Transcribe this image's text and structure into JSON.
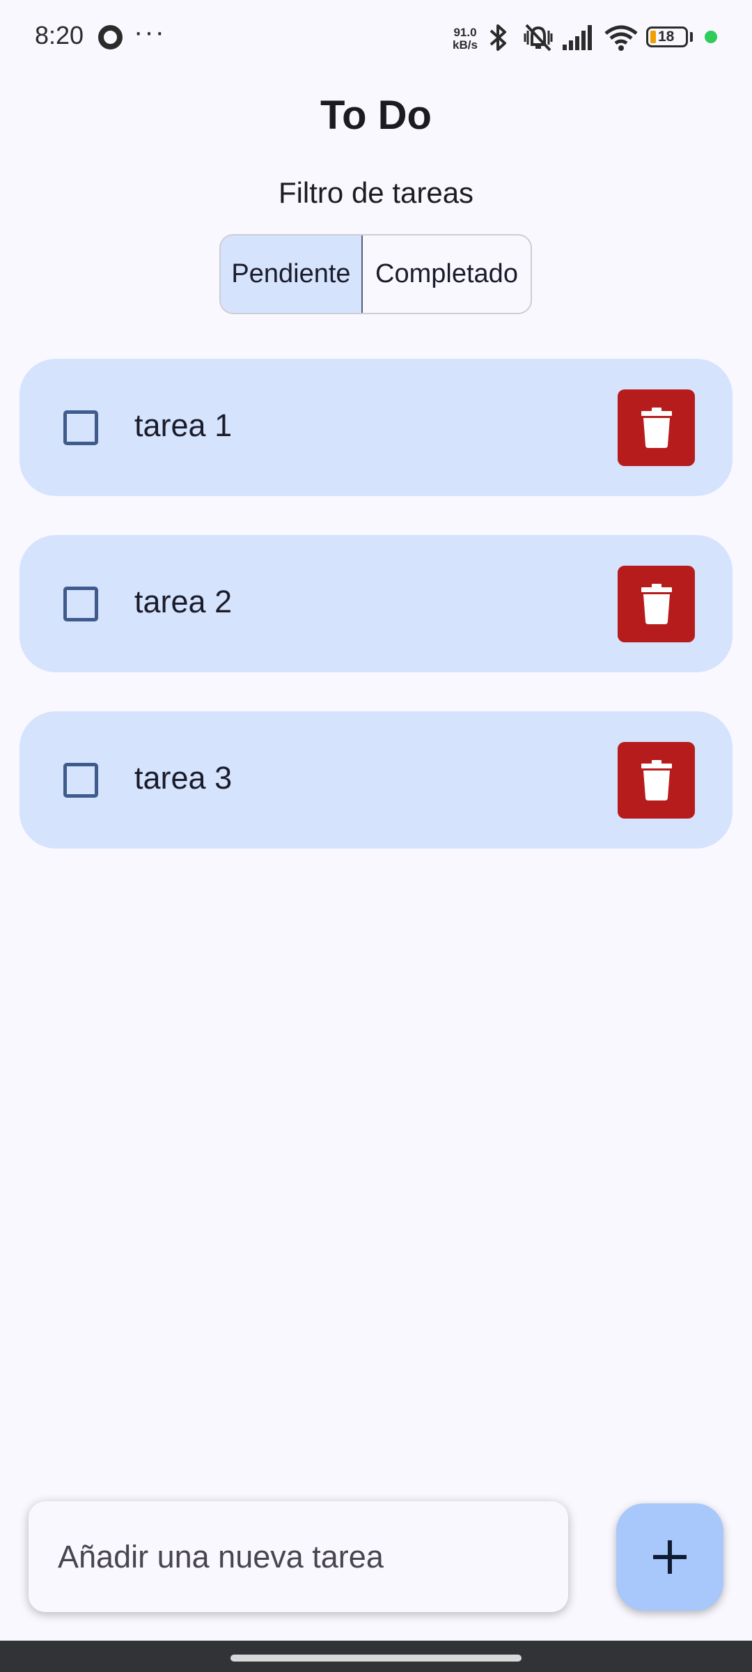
{
  "status_bar": {
    "time": "8:20",
    "more_dots": "···",
    "net_speed_value": "91.0",
    "net_speed_unit": "kB/s",
    "battery": "18",
    "icons": [
      "record-icon",
      "bluetooth-icon",
      "vibrate-mute-icon",
      "signal-icon",
      "wifi-icon",
      "battery-icon",
      "privacy-dot-icon"
    ]
  },
  "header": {
    "title": "To Do",
    "filter_label": "Filtro de tareas"
  },
  "filter": {
    "options": [
      "Pendiente",
      "Completado"
    ],
    "selected": "Pendiente"
  },
  "tasks": [
    {
      "label": "tarea 1",
      "completed": false
    },
    {
      "label": "tarea 2",
      "completed": false
    },
    {
      "label": "tarea 3",
      "completed": false
    }
  ],
  "new_task": {
    "placeholder": "Añadir una nueva tarea",
    "value": ""
  },
  "colors": {
    "background": "#f9f8fe",
    "card": "#d6e3fd",
    "delete": "#b71c1c",
    "fab": "#a8c7fa",
    "checkbox": "#3e5b8c"
  }
}
